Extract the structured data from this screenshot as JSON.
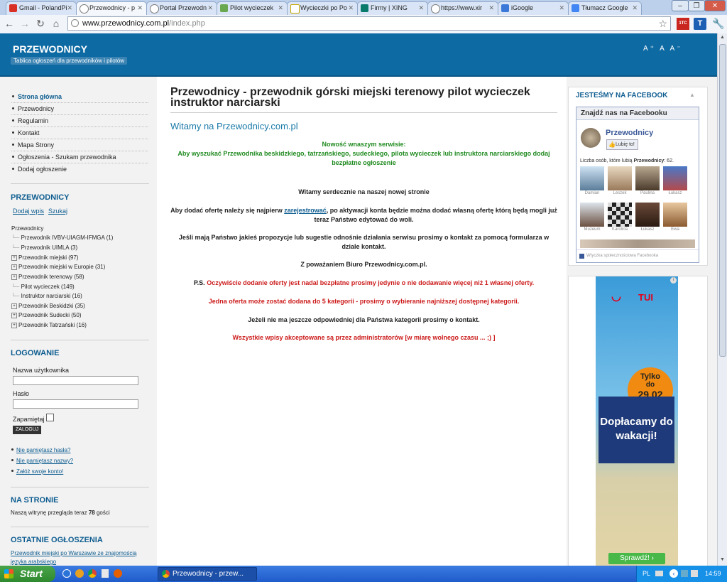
{
  "browser": {
    "tabs": [
      {
        "label": "Gmail - PolandPi",
        "icon_color": "#d93025"
      },
      {
        "label": "Przewodnicy - p",
        "icon_color": "#555555"
      },
      {
        "label": "Portal Przewodn",
        "icon_color": "#555555"
      },
      {
        "label": "Pilot wycieczek",
        "icon_color": "#6aa84f"
      },
      {
        "label": "Wycieczki po Po",
        "icon_color": "#e0c050"
      },
      {
        "label": "Firmy | XING",
        "icon_color": "#0a7a6a"
      },
      {
        "label": "https://www.xir",
        "icon_color": "#555555"
      },
      {
        "label": "iGoogle",
        "icon_color": "#3c78d8"
      },
      {
        "label": "Tłumacz Google",
        "icon_color": "#4285f4"
      }
    ],
    "url_host": "www.przewodnicy.com.pl",
    "url_path": "/index.php",
    "toolbar_badge_1": "1TC",
    "toolbar_badge_2": "T"
  },
  "site": {
    "title": "PRZEWODNICY",
    "subtitle": "Tablica ogłoszeń dla przewodników i pilotów",
    "font_size_controls": "A⁺ A A⁻"
  },
  "left": {
    "menu": [
      "Strona główna",
      "Przewodnicy",
      "Regulamin",
      "Kontakt",
      "Mapa Strony",
      "Ogłoszenia - Szukam przewodnika",
      "Dodaj ogłoszenie"
    ],
    "przewodnicy_header": "PRZEWODNICY",
    "add_entry": "Dodaj wpis",
    "search": "Szukaj",
    "tree_root": "Przewodnicy",
    "tree": [
      {
        "label": "Przewodnik IVBV-UIAGM-IFMGA (1)",
        "expandable": false
      },
      {
        "label": "Przewodnik UIMLA (3)",
        "expandable": false
      },
      {
        "label": "Przewodnik miejski (97)",
        "expandable": true
      },
      {
        "label": "Przewodnik miejski w Europie (31)",
        "expandable": true
      },
      {
        "label": "Przewodnik terenowy (58)",
        "expandable": true
      },
      {
        "label": "Pilot wycieczek (149)",
        "expandable": false
      },
      {
        "label": "Instruktor narciarski (16)",
        "expandable": false
      },
      {
        "label": "Przewodnik Beskidzki (35)",
        "expandable": true
      },
      {
        "label": "Przewodnik Sudecki (50)",
        "expandable": true
      },
      {
        "label": "Przewodnik Tatrzański (16)",
        "expandable": true
      }
    ],
    "login_header": "LOGOWANIE",
    "username_label": "Nazwa użytkownika",
    "password_label": "Hasło",
    "remember_label": "Zapamiętaj",
    "login_button": "ZALOGUJ",
    "forgot_password": "Nie pamiętasz hasła?",
    "forgot_username": "Nie pamiętasz nazwy?",
    "create_account": "Załóż swoje konto!",
    "online_header": "NA STRONIE",
    "online_text_pre": "Naszą witrynę przegląda teraz ",
    "online_count": "78",
    "online_text_post": " gości",
    "latest_header": "OSTATNIE OGŁOSZENIA",
    "latest_item": "Przewodnik miejski po Warszawie ze znajomością języka arabskiego"
  },
  "main": {
    "title": "Przewodnicy - przewodnik górski miejski terenowy pilot wycieczek instruktor narciarski",
    "welcome_heading": "Witamy na Przewodnicy.com.pl",
    "news_title": "Nowość wnaszym serwisie:",
    "news_body": "Aby wyszukać Przewodnika beskidzkiego, tatrzańskiego, sudeckiego, pilota wycieczek lub instruktora narciarskiego dodaj bezpłatne ogłoszenie",
    "welcome_line": "Witamy serdecznie na naszej nowej stronie",
    "offer_pre": "Aby dodać ofertę należy się najpierw ",
    "offer_link": "zarejestrować",
    "offer_post": ", po aktywacji konta będzie można dodać własną ofertę którą będą mogli już teraz Państwo edytować do woli.",
    "proposals": "Jeśli mają Państwo jakieś propozycje lub sugestie odnośnie działania serwisu prosimy o kontakt za pomocą formularza w dziale kontakt.",
    "regards": "Z poważaniem Biuro Przewodnicy.com.pl.",
    "ps_prefix": "P.S.",
    "ps_text": " Oczywiście dodanie oferty jest nadal bezpłatne prosimy jedynie o nie dodawanie więcej niż 1 własnej oferty.",
    "categories_note": "Jedna oferta może zostać dodana do 5 kategorii - prosimy o wybieranie najniższej dostępnej kategorii.",
    "no_category": "Jeżeli nie ma jeszcze odpowiedniej dla Państwa kategorii prosimy o kontakt.",
    "accepted": "Wszystkie wpisy akceptowane są przez administratorów [w miarę wolnego czasu ... ;) ]"
  },
  "right": {
    "fb_header": "JESTEŚMY NA FACEBOOK",
    "fb_find": "Znajdź nas na Facebooku",
    "fb_page": "Przewodnicy",
    "fb_like": "Lubię to!",
    "fb_count_pre": "Liczba osób, które lubią ",
    "fb_count_page": "Przewodnicy",
    "fb_count_post": ": 62.",
    "fb_faces": [
      "Damian",
      "Leszek",
      "Paulina",
      "Łukasz",
      "Muzeum",
      "Karolina",
      "Łukasz",
      "Ewa"
    ],
    "fb_plugin": "Wtyczka społecznościowa Facebooka",
    "ad_brand": "TUI",
    "ad_badge_line1": "Tylko",
    "ad_badge_line2": "do",
    "ad_badge_date": "29.02",
    "ad_slogan": "Dopłacamy do wakacji!",
    "ad_button": "Sprawdź!"
  },
  "taskbar": {
    "start": "Start",
    "task_item": "Przewodnicy - przew...",
    "lang": "PL",
    "clock": "14:59"
  },
  "colors": {
    "header_blue": "#0e6aa3",
    "link_blue": "#0e5d90",
    "green": "#1f8a1f",
    "red": "#cc1a1a"
  }
}
